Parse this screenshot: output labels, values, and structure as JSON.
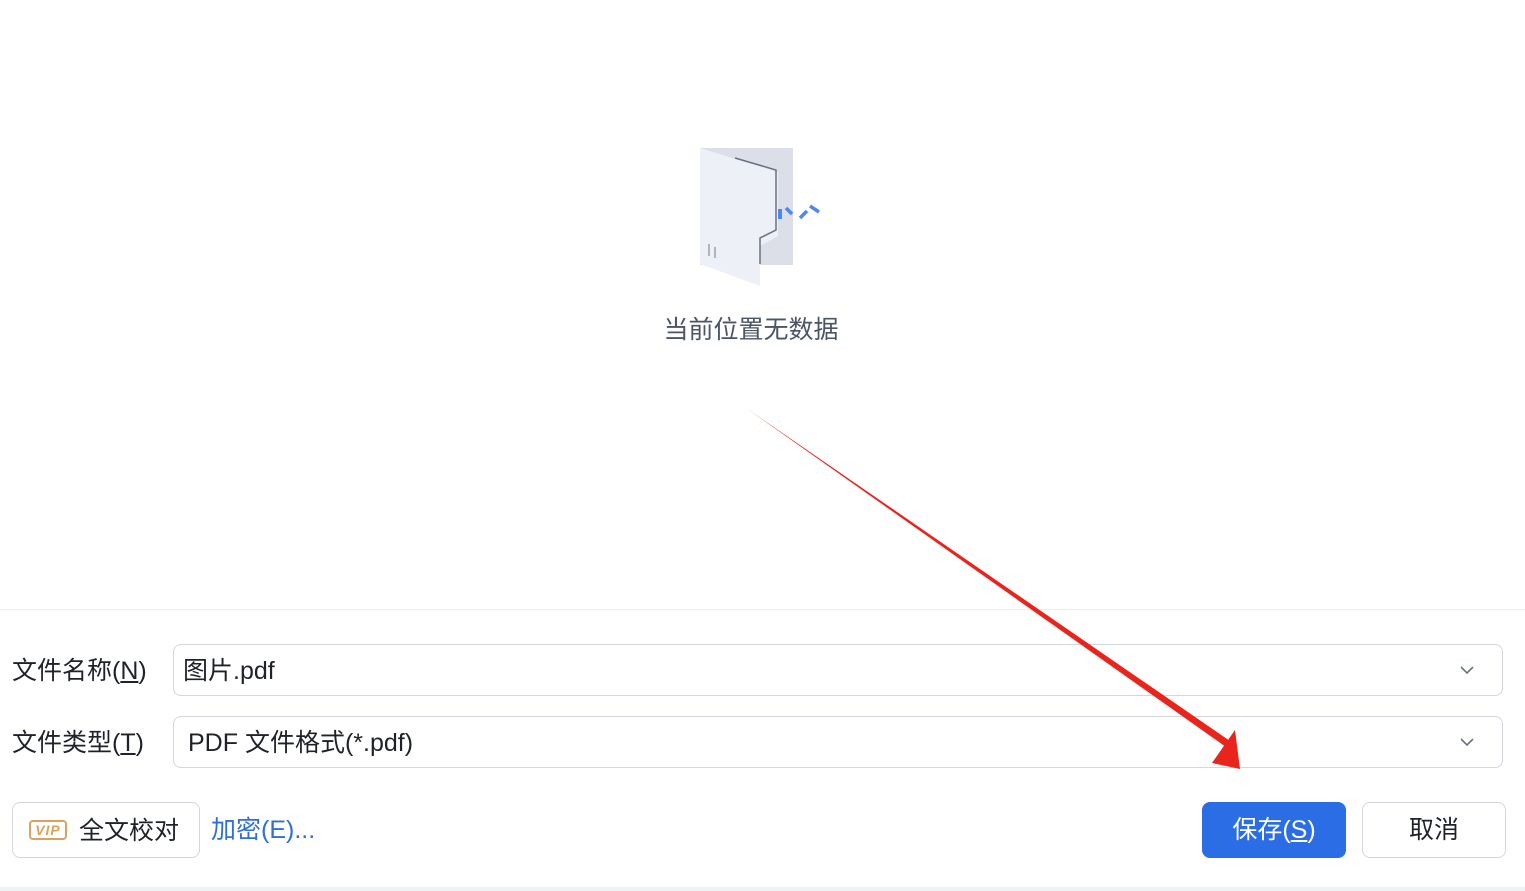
{
  "empty_state": {
    "message": "当前位置无数据",
    "icon": "empty-folder-icon"
  },
  "form": {
    "file_name": {
      "label": "文件名称(",
      "label_key": "N",
      "label_end": ")",
      "value": "图片.pdf"
    },
    "file_type": {
      "label": "文件类型(",
      "label_key": "T",
      "label_end": ")",
      "value": "PDF 文件格式(*.pdf)"
    }
  },
  "bottom_bar": {
    "vip_badge": "VIP",
    "proofread_label": "全文校对",
    "encrypt_link": "加密(E)...",
    "save_label": "保存(",
    "save_key": "S",
    "save_label_end": ")",
    "cancel_label": "取消"
  },
  "colors": {
    "primary": "#2b6de5",
    "link": "#2f6fd6",
    "vip": "#d9a35e",
    "annotation_arrow": "#e8241c"
  }
}
